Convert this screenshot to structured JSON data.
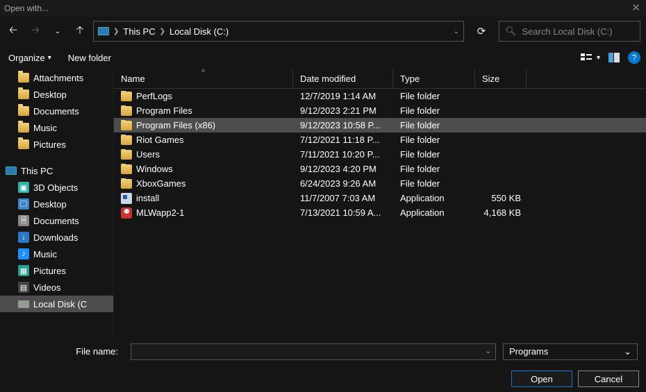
{
  "title": "Open with...",
  "breadcrumb": {
    "root_icon": "pc",
    "items": [
      "This PC",
      "Local Disk (C:)"
    ]
  },
  "search": {
    "placeholder": "Search Local Disk (C:)"
  },
  "toolbar": {
    "organize": "Organize",
    "newfolder": "New folder",
    "help": "?"
  },
  "sidebar": {
    "quick": [
      {
        "label": "Attachments",
        "indent": 1,
        "icon": "folder"
      },
      {
        "label": "Desktop",
        "indent": 1,
        "icon": "folder"
      },
      {
        "label": "Documents",
        "indent": 1,
        "icon": "folder"
      },
      {
        "label": "Music",
        "indent": 1,
        "icon": "folder"
      },
      {
        "label": "Pictures",
        "indent": 1,
        "icon": "folder"
      }
    ],
    "thispc_label": "This PC",
    "thispc_items": [
      {
        "label": "3D Objects",
        "icon": "3d",
        "color": "#2fb5a8"
      },
      {
        "label": "Desktop",
        "icon": "desktop",
        "color": "#3d85c6"
      },
      {
        "label": "Documents",
        "icon": "doc",
        "color": "#888"
      },
      {
        "label": "Downloads",
        "icon": "down",
        "color": "#2b78c2"
      },
      {
        "label": "Music",
        "icon": "music",
        "color": "#1e90ff"
      },
      {
        "label": "Pictures",
        "icon": "pic",
        "color": "#2a9d8f"
      },
      {
        "label": "Videos",
        "icon": "vid",
        "color": "#444"
      },
      {
        "label": "Local Disk (C",
        "icon": "drive",
        "selected": true
      }
    ]
  },
  "columns": {
    "name": "Name",
    "date": "Date modified",
    "type": "Type",
    "size": "Size"
  },
  "rows": [
    {
      "name": "PerfLogs",
      "date": "12/7/2019 1:14 AM",
      "type": "File folder",
      "size": "",
      "icon": "folder"
    },
    {
      "name": "Program Files",
      "date": "9/12/2023 2:21 PM",
      "type": "File folder",
      "size": "",
      "icon": "folder"
    },
    {
      "name": "Program Files (x86)",
      "date": "9/12/2023 10:58 P...",
      "type": "File folder",
      "size": "",
      "icon": "folder",
      "selected": true
    },
    {
      "name": "Riot Games",
      "date": "7/12/2021 11:18 P...",
      "type": "File folder",
      "size": "",
      "icon": "folder"
    },
    {
      "name": "Users",
      "date": "7/11/2021 10:20 P...",
      "type": "File folder",
      "size": "",
      "icon": "folder"
    },
    {
      "name": "Windows",
      "date": "9/12/2023 4:20 PM",
      "type": "File folder",
      "size": "",
      "icon": "folder"
    },
    {
      "name": "XboxGames",
      "date": "6/24/2023 9:26 AM",
      "type": "File folder",
      "size": "",
      "icon": "folder"
    },
    {
      "name": "install",
      "date": "11/7/2007 7:03 AM",
      "type": "Application",
      "size": "550 KB",
      "icon": "app"
    },
    {
      "name": "MLWapp2-1",
      "date": "7/13/2021 10:59 A...",
      "type": "Application",
      "size": "4,168 KB",
      "icon": "mlw"
    }
  ],
  "bottom": {
    "filename_label": "File name:",
    "filter": "Programs"
  },
  "buttons": {
    "open": "Open",
    "cancel": "Cancel"
  }
}
